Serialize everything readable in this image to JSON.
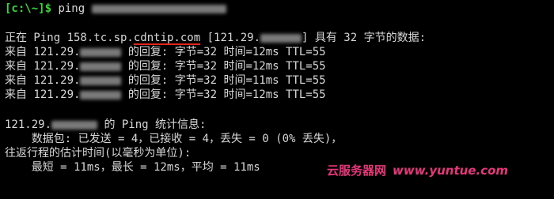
{
  "prompt": {
    "text": "[c:\\~]$",
    "command": "ping"
  },
  "ping_header": {
    "prefix": "正在 Ping 158.tc.sp.",
    "highlighted_host": "cdntip.com",
    "ip_open": " [121.29.",
    "ip_close": "] 具有 32 字节的数据:"
  },
  "replies": [
    {
      "prefix": "来自 121.29.",
      "suffix": " 的回复: 字节=32 时间=12ms TTL=55"
    },
    {
      "prefix": "来自 121.29.",
      "suffix": " 的回复: 字节=32 时间=12ms TTL=55"
    },
    {
      "prefix": "来自 121.29.",
      "suffix": " 的回复: 字节=32 时间=11ms TTL=55"
    },
    {
      "prefix": "来自 121.29.",
      "suffix": " 的回复: 字节=32 时间=12ms TTL=55"
    }
  ],
  "stats": {
    "header_prefix": "121.29.",
    "header_suffix": " 的 Ping 统计信息:",
    "packets": "    数据包: 已发送 = 4，已接收 = 4，丢失 = 0 (0% 丢失)，",
    "rtt_header": "往返行程的估计时间(以毫秒为单位):",
    "rtt_values": "    最短 = 11ms，最长 = 12ms，平均 = 11ms"
  },
  "watermark": {
    "text_cn": "云服务器网",
    "url": "www.yuntue.com"
  },
  "colors": {
    "prompt": "#39d639",
    "text": "#d8d8d8",
    "background": "#000000",
    "underline": "#e2261c",
    "watermark": "#e8367a"
  }
}
